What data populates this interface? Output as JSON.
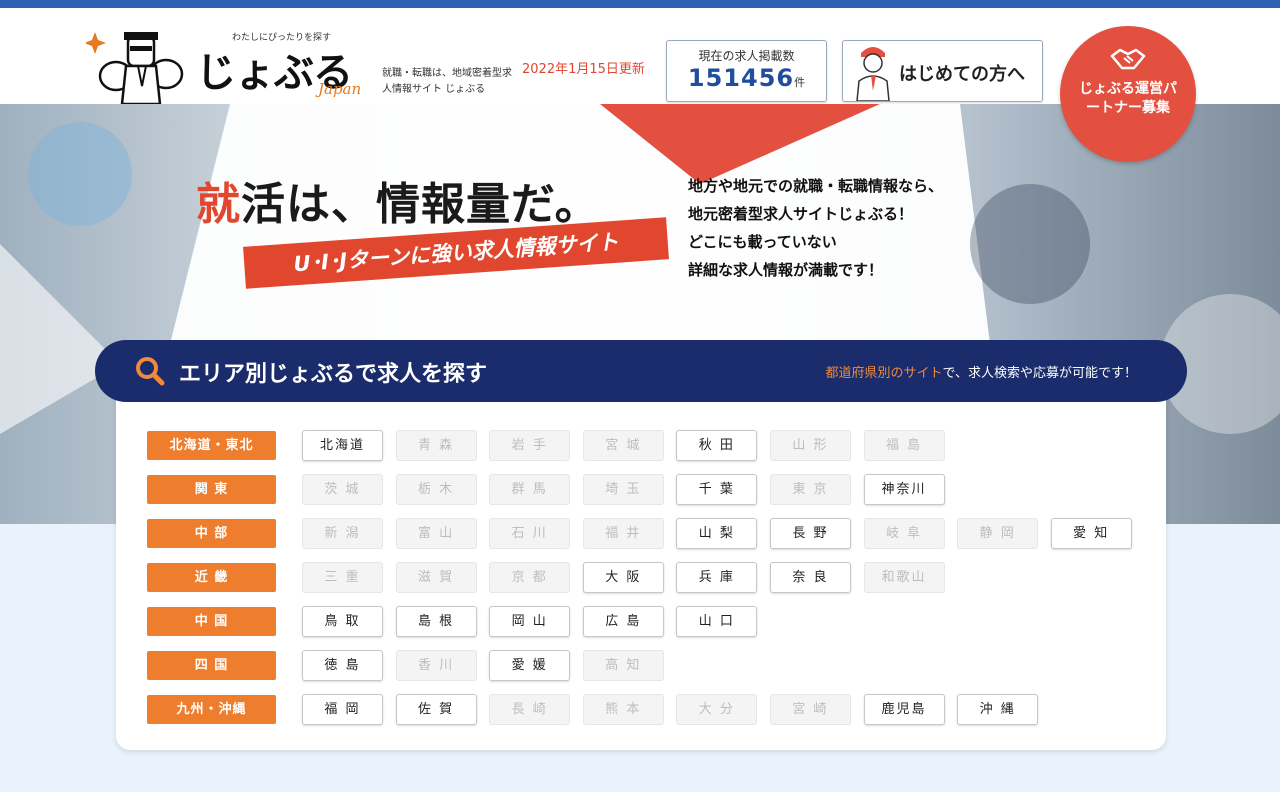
{
  "header": {
    "tagline": "わたしにぴったりを探す",
    "logo_text": "じょぶる",
    "logo_sub": "Japan",
    "site_desc": "就職・転職は、地域密着型求人情報サイト じょぶる",
    "update_date": "2022年1月15日更新",
    "count_label": "現在の求人掲載数",
    "count_value": "151456",
    "count_unit": "件",
    "first_visit_label": "はじめての方へ",
    "partner_label": "じょぶる運営パートナー募集"
  },
  "hero": {
    "title_first": "就",
    "title_rest": "活は、情報量だ。",
    "ribbon": "U･I･Jターンに強い求人情報サイト",
    "desc_line1": "地方や地元での就職・転職情報なら、",
    "desc_line2": "地元密着型求人サイトじょぶる！",
    "desc_line3": "どこにも載っていない",
    "desc_line4": "詳細な求人情報が満載です！"
  },
  "area": {
    "title": "エリア別じょぶるで求人を探す",
    "note_highlight": "都道府県別のサイト",
    "note_rest": "で、求人検索や応募が可能です！"
  },
  "regions": [
    {
      "label": "北海道・東北",
      "prefs": [
        {
          "name": "北海道",
          "active": true
        },
        {
          "name": "青 森",
          "active": false
        },
        {
          "name": "岩 手",
          "active": false
        },
        {
          "name": "宮 城",
          "active": false
        },
        {
          "name": "秋 田",
          "active": true
        },
        {
          "name": "山 形",
          "active": false
        },
        {
          "name": "福 島",
          "active": false
        }
      ]
    },
    {
      "label": "関 東",
      "prefs": [
        {
          "name": "茨 城",
          "active": false
        },
        {
          "name": "栃 木",
          "active": false
        },
        {
          "name": "群 馬",
          "active": false
        },
        {
          "name": "埼 玉",
          "active": false
        },
        {
          "name": "千 葉",
          "active": true
        },
        {
          "name": "東 京",
          "active": false
        },
        {
          "name": "神奈川",
          "active": true
        }
      ]
    },
    {
      "label": "中 部",
      "prefs": [
        {
          "name": "新 潟",
          "active": false
        },
        {
          "name": "富 山",
          "active": false
        },
        {
          "name": "石 川",
          "active": false
        },
        {
          "name": "福 井",
          "active": false
        },
        {
          "name": "山 梨",
          "active": true
        },
        {
          "name": "長 野",
          "active": true
        },
        {
          "name": "岐 阜",
          "active": false
        },
        {
          "name": "静 岡",
          "active": false
        },
        {
          "name": "愛 知",
          "active": true
        }
      ]
    },
    {
      "label": "近 畿",
      "prefs": [
        {
          "name": "三 重",
          "active": false
        },
        {
          "name": "滋 賀",
          "active": false
        },
        {
          "name": "京 都",
          "active": false
        },
        {
          "name": "大 阪",
          "active": true
        },
        {
          "name": "兵 庫",
          "active": true
        },
        {
          "name": "奈 良",
          "active": true
        },
        {
          "name": "和歌山",
          "active": false
        }
      ]
    },
    {
      "label": "中 国",
      "prefs": [
        {
          "name": "鳥 取",
          "active": true
        },
        {
          "name": "島 根",
          "active": true
        },
        {
          "name": "岡 山",
          "active": true
        },
        {
          "name": "広 島",
          "active": true
        },
        {
          "name": "山 口",
          "active": true
        }
      ]
    },
    {
      "label": "四 国",
      "prefs": [
        {
          "name": "徳 島",
          "active": true
        },
        {
          "name": "香 川",
          "active": false
        },
        {
          "name": "愛 媛",
          "active": true
        },
        {
          "name": "高 知",
          "active": false
        }
      ]
    },
    {
      "label": "九州・沖縄",
      "prefs": [
        {
          "name": "福 岡",
          "active": true
        },
        {
          "name": "佐 賀",
          "active": true
        },
        {
          "name": "長 崎",
          "active": false
        },
        {
          "name": "熊 本",
          "active": false
        },
        {
          "name": "大 分",
          "active": false
        },
        {
          "name": "宮 崎",
          "active": false
        },
        {
          "name": "鹿児島",
          "active": true
        },
        {
          "name": "沖 縄",
          "active": true
        }
      ]
    }
  ],
  "colors": {
    "navy": "#1a2c6b",
    "orange": "#ee7d2e",
    "red": "#e1472f",
    "blue": "#1f4da0"
  },
  "icons": [
    "mascot-icon",
    "person-icon",
    "handshake-icon",
    "search-icon"
  ]
}
